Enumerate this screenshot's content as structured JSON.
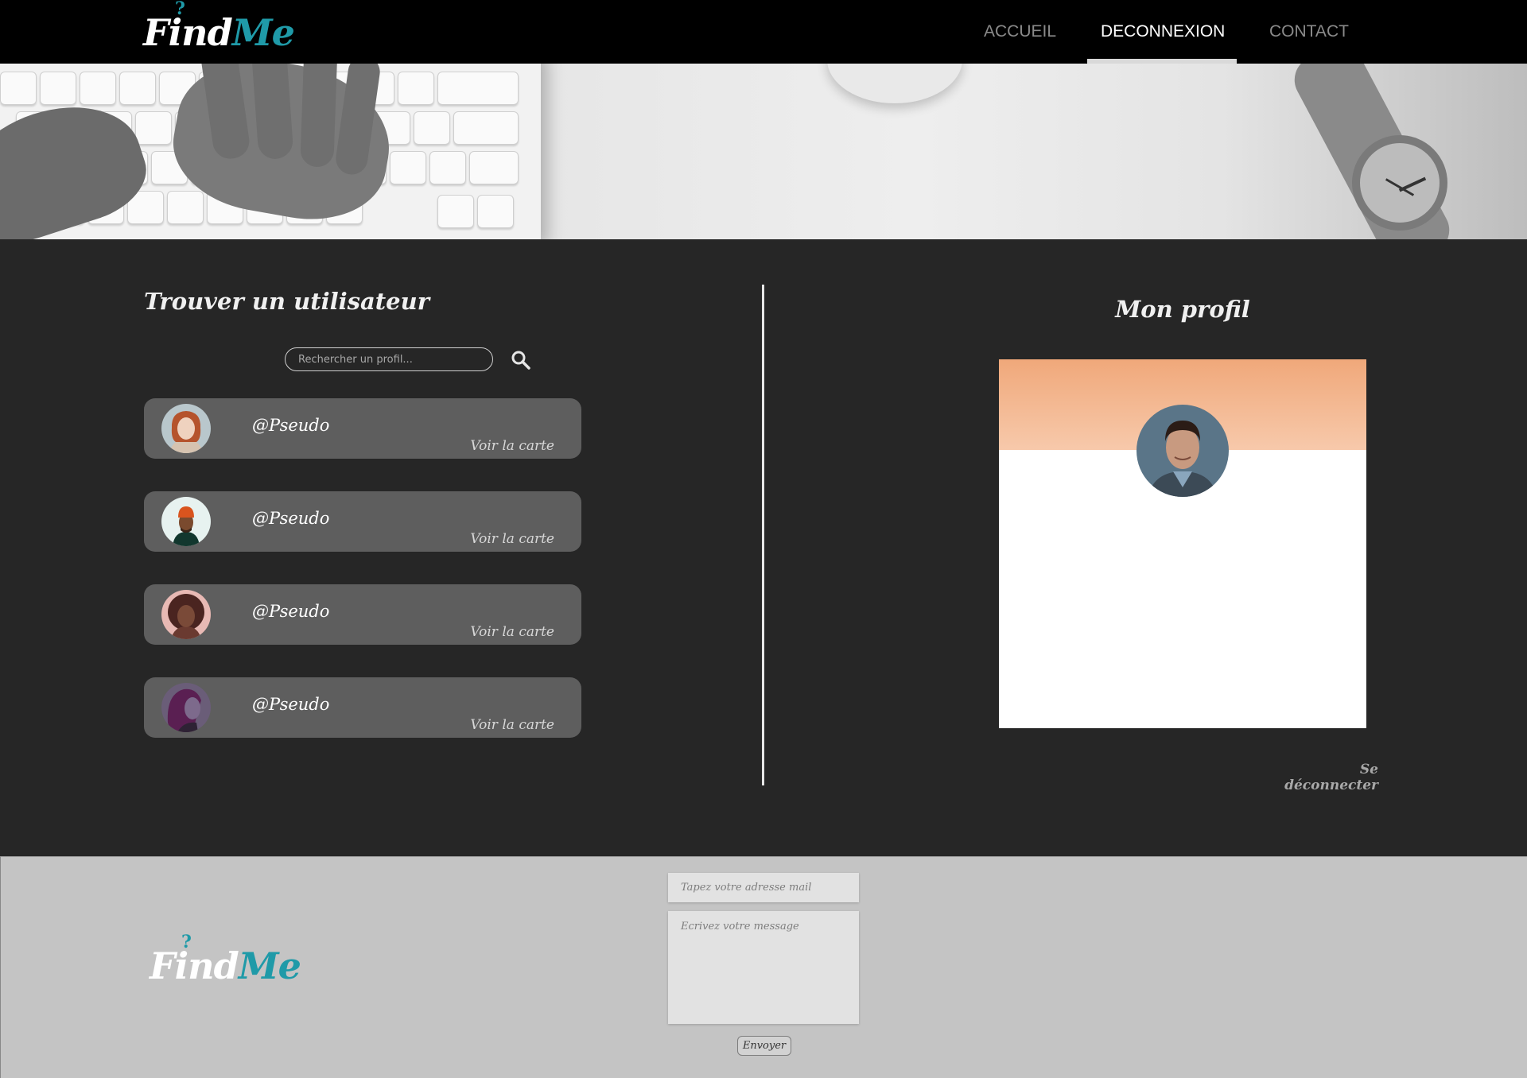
{
  "brand": {
    "logo_part1": "Find",
    "logo_part2": "Me",
    "logo_mark": "?",
    "primary_color": "#1f9aa8",
    "nav_bg": "#000000",
    "body_bg": "#262626",
    "footer_bg": "#c4c4c4"
  },
  "nav": {
    "links": [
      {
        "label": "ACCUEIL",
        "active": false
      },
      {
        "label": "DECONNEXION",
        "active": true
      },
      {
        "label": "CONTACT",
        "active": false
      }
    ]
  },
  "search": {
    "title": "Trouver un utilisateur",
    "placeholder": "Rechercher un profil...",
    "icon": "search-icon"
  },
  "users": [
    {
      "pseudo": "@Pseudo",
      "link": "Voir la carte",
      "avatar": "avatar-red-hair-woman"
    },
    {
      "pseudo": "@Pseudo",
      "link": "Voir la carte",
      "avatar": "avatar-orange-beanie-man"
    },
    {
      "pseudo": "@Pseudo",
      "link": "Voir la carte",
      "avatar": "avatar-curly-hair-woman"
    },
    {
      "pseudo": "@Pseudo",
      "link": "Voir la carte",
      "avatar": "avatar-purple-hair-woman"
    }
  ],
  "profile": {
    "title": "Mon profil",
    "avatar": "avatar-smiling-man",
    "header_color": "#f0a87a",
    "logout_label": "Se déconnecter"
  },
  "footer": {
    "mail_placeholder": "Tapez votre adresse mail",
    "message_placeholder": "Ecrivez votre message",
    "send_label": "Envoyer"
  }
}
